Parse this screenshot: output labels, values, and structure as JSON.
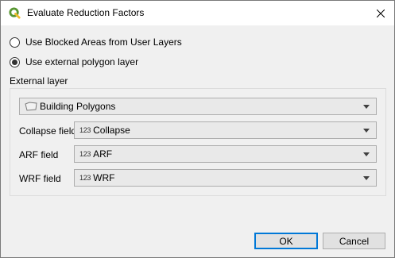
{
  "window": {
    "title": "Evaluate Reduction Factors",
    "icon": "qgis-icon",
    "close_icon": "close-icon"
  },
  "options": [
    {
      "label": "Use Blocked Areas from User Layers",
      "selected": false
    },
    {
      "label": "Use external polygon layer",
      "selected": true
    }
  ],
  "external_layer": {
    "group_label": "External layer",
    "layer_value": "Building Polygons",
    "layer_icon": "polygon-layer-icon",
    "fields": [
      {
        "label": "Collapse field",
        "type_icon": "123",
        "value": "Collapse"
      },
      {
        "label": "ARF field",
        "type_icon": "123",
        "value": "ARF"
      },
      {
        "label": "WRF field",
        "type_icon": "123",
        "value": "WRF"
      }
    ]
  },
  "buttons": {
    "ok": "OK",
    "cancel": "Cancel"
  },
  "colors": {
    "focus_border": "#0078d7",
    "window_bg": "#f0f0f0",
    "qgis_green": "#589632",
    "qgis_yellow": "#eebc2d"
  }
}
